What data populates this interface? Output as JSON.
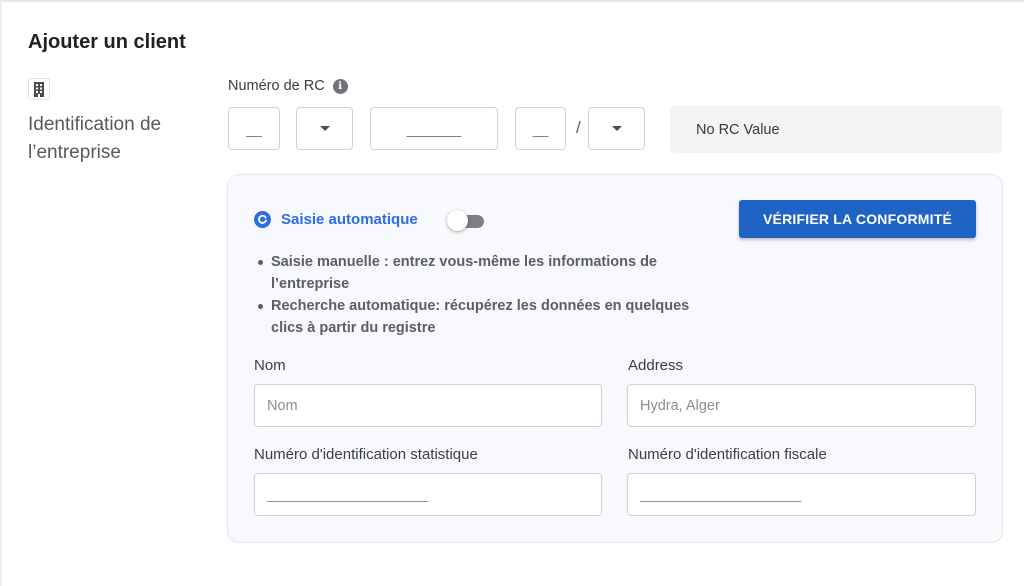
{
  "page": {
    "title": "Ajouter un client"
  },
  "section": {
    "label": "Identification de l’entreprise",
    "icon": "building-icon"
  },
  "rc": {
    "label": "Numéro de RC",
    "info_icon": "i",
    "field1_placeholder": "__",
    "field3_placeholder": "_______",
    "field4_placeholder": "__",
    "separator": "/",
    "value_display": "No RC Value"
  },
  "auto": {
    "label": "Saisie automatique",
    "toggle_on": false,
    "verify_button": "VÉRIFIER LA CONFORMITÉ",
    "bullets": [
      "Saisie manuelle : entrez vous-même les informations de l’entreprise",
      "Recherche automatique: récupérez les données en quelques clics à partir du registre"
    ]
  },
  "fields": {
    "nom": {
      "label": "Nom",
      "placeholder": "Nom"
    },
    "address": {
      "label": "Address",
      "placeholder": "Hydra, Alger"
    },
    "nis": {
      "label": "Numéro d'identification statistique",
      "placeholder": "____________________"
    },
    "nif": {
      "label": "Numéro d'identification fiscale",
      "placeholder": "____________________"
    }
  },
  "colors": {
    "accent": "#2d6ee0",
    "button": "#1f63c4",
    "panel_bg": "#f7f9fd"
  }
}
